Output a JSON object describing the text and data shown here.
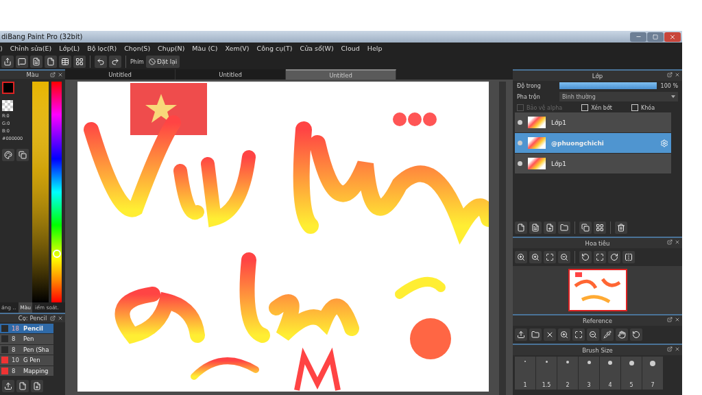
{
  "window": {
    "title": "diBang Paint Pro (32bit)"
  },
  "menu": [
    ")",
    "Chỉnh sửa(E)",
    "Lớp(L)",
    "Bộ lọc(R)",
    "Chọn(S)",
    "Chụp(N)",
    "Màu (C)",
    "Xem(V)",
    "Công cụ(T)",
    "Cửa sổ(W)",
    "Cloud",
    "Help"
  ],
  "toolbar": {
    "shortcut_label": "Phím",
    "reset_button": "Đặt lại"
  },
  "doc_tabs": [
    {
      "label": "Untitled",
      "selected": false
    },
    {
      "label": "Untitled",
      "selected": false
    },
    {
      "label": "Untitled",
      "selected": true
    }
  ],
  "color_panel": {
    "title": "Màu",
    "rgb": [
      "R:0",
      "G:0",
      "B:0"
    ],
    "hex": "#000000",
    "hue": {
      "level": 0.22
    },
    "tabs": [
      {
        "label": "áng ..",
        "selected": false
      },
      {
        "label": "Màu",
        "selected": true
      },
      {
        "label": "iểm soát.",
        "selected": false
      }
    ]
  },
  "brush_panel": {
    "title": "Cọ: Pencil",
    "brushes": [
      {
        "size": "18",
        "name": "Pencil",
        "color": "#2a2a2a",
        "selected": true
      },
      {
        "size": "8",
        "name": "Pen",
        "color": "#2a2a2a",
        "selected": false
      },
      {
        "size": "8",
        "name": "Pen (Sha",
        "color": "#2a2a2a",
        "selected": false
      },
      {
        "size": "10",
        "name": "G Pen",
        "color": "#ee3333",
        "selected": false
      },
      {
        "size": "8",
        "name": "Mapping",
        "color": "#ee3333",
        "selected": false
      }
    ]
  },
  "layer_panel": {
    "title": "Lớp",
    "opacity_label": "Độ trong",
    "opacity": {
      "level": 1,
      "reading": "100 %"
    },
    "blend_label": "Pha trộn",
    "blend_value": "Bình thường",
    "options": [
      {
        "label": "Bảo vệ alpha",
        "checked": false,
        "disabled": true
      },
      {
        "label": "Xén bớt",
        "checked": false,
        "disabled": false
      },
      {
        "label": "Khóa",
        "checked": false,
        "disabled": false
      }
    ],
    "layers": [
      {
        "name": "Lớp1",
        "selected": false
      },
      {
        "name": "@phuongchichi",
        "selected": true
      },
      {
        "name": "Lớp1",
        "selected": false
      }
    ]
  },
  "navigator_panel": {
    "title": "Hoa tiêu"
  },
  "reference_panel": {
    "title": "Reference"
  },
  "brush_size_panel": {
    "title": "Brush Size",
    "sizes": [
      "1",
      "1.5",
      "2",
      "3",
      "4",
      "5",
      "7"
    ]
  }
}
